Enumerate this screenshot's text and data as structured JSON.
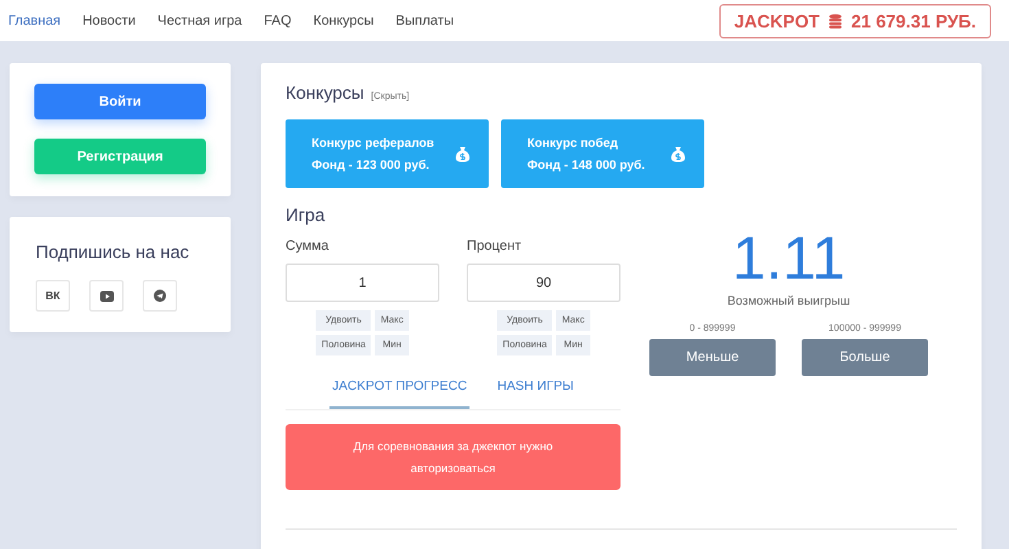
{
  "nav": {
    "items": [
      {
        "label": "Главная",
        "selected": true
      },
      {
        "label": "Новости",
        "selected": false
      },
      {
        "label": "Честная игра",
        "selected": false
      },
      {
        "label": "FAQ",
        "selected": false
      },
      {
        "label": "Конкурсы",
        "selected": false
      },
      {
        "label": "Выплаты",
        "selected": false
      }
    ],
    "jackpot": {
      "label": "JACKPOT",
      "amount": "21 679.31 РУБ."
    }
  },
  "auth": {
    "login": "Войти",
    "register": "Регистрация"
  },
  "social": {
    "title": "Подпишись на нас",
    "links": [
      {
        "kind": "vk",
        "label": "ВК"
      },
      {
        "kind": "youtube"
      },
      {
        "kind": "telegram"
      }
    ]
  },
  "contests": {
    "title": "Конкурсы",
    "hide_link": "[Скрыть]",
    "cards": [
      {
        "name": "Конкурс рефералов",
        "fund": "Фонд - 123 000 руб."
      },
      {
        "name": "Конкурс побед",
        "fund": "Фонд - 148 000 руб."
      }
    ]
  },
  "game": {
    "title": "Игра",
    "fields": [
      {
        "label": "Сумма",
        "value": "1",
        "buttons": [
          "Удвоить",
          "Макс",
          "Половина",
          "Мин"
        ]
      },
      {
        "label": "Процент",
        "value": "90",
        "buttons": [
          "Удвоить",
          "Макс",
          "Половина",
          "Мин"
        ]
      }
    ],
    "tabs": [
      {
        "label": "JACKPOT ПРОГРЕСС",
        "selected": true
      },
      {
        "label": "HASH ИГРЫ",
        "selected": false
      }
    ],
    "alert": "Для соревнования за джекпот нужно авторизоваться",
    "multiplier": "1.11",
    "multiplier_caption": "Возможный выигрыш",
    "bets": [
      {
        "range": "0 - 899999",
        "label": "Меньше"
      },
      {
        "range": "100000 - 999999",
        "label": "Больше"
      }
    ]
  }
}
